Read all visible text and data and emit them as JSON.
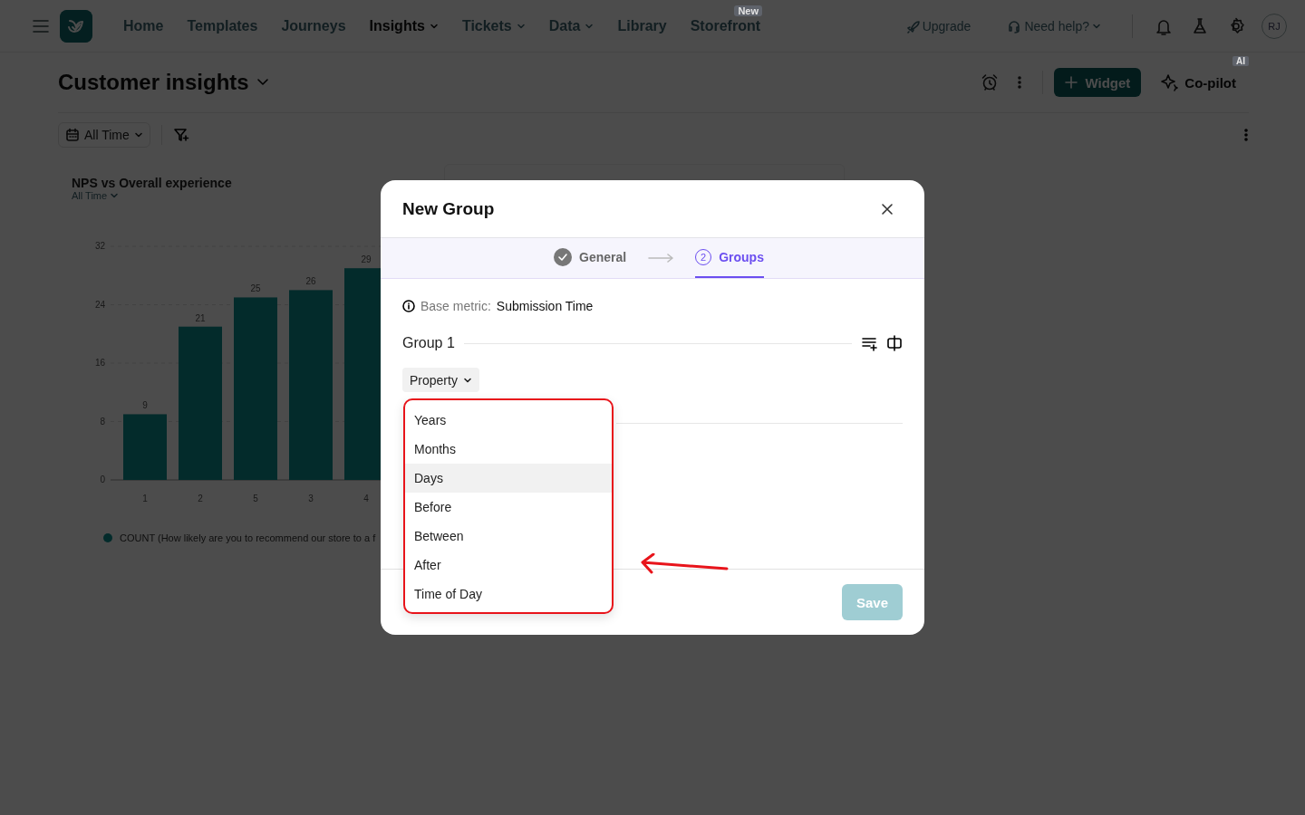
{
  "topbar": {
    "nav": [
      {
        "label": "Home",
        "selected": false,
        "dropdown": false
      },
      {
        "label": "Templates",
        "selected": false,
        "dropdown": false
      },
      {
        "label": "Journeys",
        "selected": false,
        "dropdown": false
      },
      {
        "label": "Insights",
        "selected": true,
        "dropdown": true
      },
      {
        "label": "Tickets",
        "selected": false,
        "dropdown": true
      },
      {
        "label": "Data",
        "selected": false,
        "dropdown": true
      },
      {
        "label": "Library",
        "selected": false,
        "dropdown": false
      },
      {
        "label": "Storefront",
        "selected": false,
        "dropdown": false,
        "badge": "New"
      }
    ],
    "upgrade": "Upgrade",
    "help": "Need help?",
    "avatar": "RJ"
  },
  "header": {
    "title": "Customer insights",
    "widget_button": "Widget",
    "copilot": "Co-pilot",
    "copilot_badge": "AI"
  },
  "filters": {
    "date_range": "All Time"
  },
  "chart_card": {
    "title": "NPS vs Overall experience",
    "range": "All Time",
    "chart_data": {
      "type": "bar",
      "categories": [
        "1",
        "2",
        "5",
        "3",
        "4"
      ],
      "yticks": [
        0,
        8,
        16,
        24,
        32
      ],
      "ylim": [
        0,
        32
      ],
      "data_labels": true,
      "series": [
        {
          "name": "COUNT (How likely are you to recommend our store to a f",
          "color": "#0d8f8f",
          "values": [
            9,
            21,
            25,
            26,
            29
          ]
        }
      ]
    }
  },
  "modal": {
    "title": "New Group",
    "steps": [
      {
        "kind": "done",
        "label": "General",
        "selected": false
      },
      {
        "kind": "number",
        "number": "2",
        "label": "Groups",
        "selected": true
      }
    ],
    "base_metric_label": "Base metric:",
    "base_metric": "Submission Time",
    "group_title": "Group 1",
    "property_button": "Property",
    "menu": {
      "items": [
        {
          "label": "Years",
          "highlighted": false
        },
        {
          "label": "Months",
          "highlighted": false
        },
        {
          "label": "Days",
          "highlighted": true
        },
        {
          "label": "Before",
          "highlighted": false
        },
        {
          "label": "Between",
          "highlighted": false
        },
        {
          "label": "After",
          "highlighted": false
        },
        {
          "label": "Time of Day",
          "highlighted": false
        }
      ]
    },
    "save_button": "Save",
    "save_disabled": true
  }
}
